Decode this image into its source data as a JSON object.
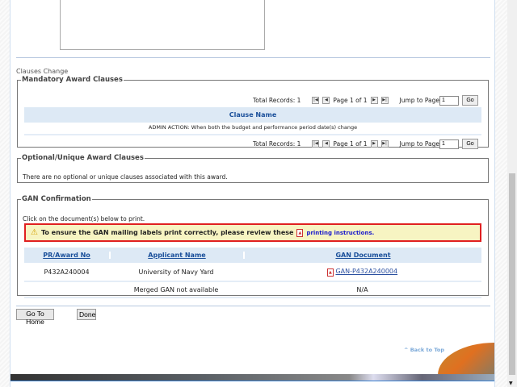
{
  "clauses_change_label": "Clauses Change",
  "mandatory": {
    "legend": "Mandatory Award Clauses",
    "total_records": "Total Records: 1",
    "page_text": "Page 1 of 1",
    "jump_label": "Jump to Page",
    "jump_value": "1",
    "go": "Go",
    "column": "Clause Name",
    "rows": [
      "ADMIN ACTION: When both the budget and performance period date(s) change"
    ]
  },
  "optional": {
    "legend": "Optional/Unique Award Clauses",
    "text": "There are no optional or unique clauses associated with this award."
  },
  "gan": {
    "legend": "GAN Confirmation",
    "instruction": "Click on the document(s) below to print.",
    "warning": "To ensure the GAN mailing labels print correctly, please review these",
    "warning_link": "printing instructions.",
    "columns": [
      "PR/Award No",
      "Applicant Name",
      "GAN Document"
    ],
    "rows": [
      {
        "award": "P432A240004",
        "applicant": "University of Navy Yard",
        "doc": "GAN-P432A240004"
      },
      {
        "award": "",
        "applicant": "Merged GAN not available",
        "doc": "N/A"
      }
    ]
  },
  "buttons": {
    "home": "Go To Home",
    "done": "Done"
  },
  "back_to_top": "^ Back to Top",
  "colors": {
    "accent": "#1a4f9a",
    "warning_border": "#e02020",
    "warning_bg": "#f7f4c2"
  }
}
